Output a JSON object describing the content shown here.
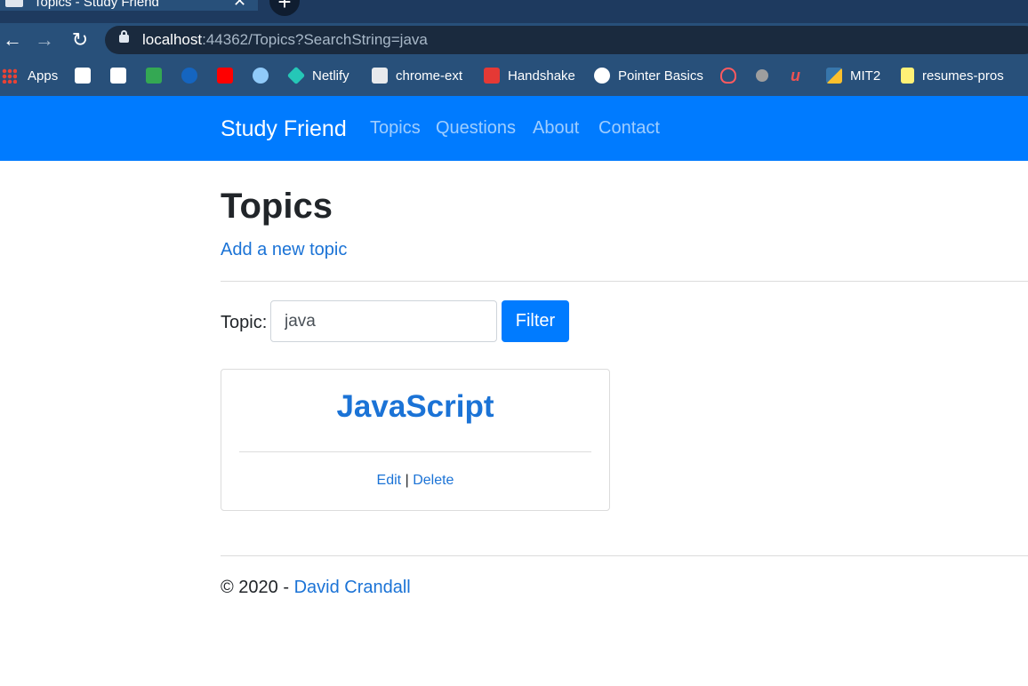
{
  "browser": {
    "tab_title": "Topics - Study Friend",
    "url_host": "localhost",
    "url_rest": ":44362/Topics?SearchString=java",
    "bookmarks": [
      {
        "label": "Apps",
        "icon": "apps-grid-icon"
      },
      {
        "label": "",
        "icon": "amazon-icon",
        "color": "#ffffff"
      },
      {
        "label": "",
        "icon": "gmail-icon",
        "color": "#ffffff"
      },
      {
        "label": "",
        "icon": "bookmark-app-icon",
        "color": "#34a853"
      },
      {
        "label": "",
        "icon": "edge-icon",
        "color": "#1565c0"
      },
      {
        "label": "",
        "icon": "youtube-icon",
        "color": "#ff0000"
      },
      {
        "label": "",
        "icon": "cloud-download-icon",
        "color": "#90caf9"
      },
      {
        "label": "Netlify",
        "icon": "netlify-icon",
        "color": "#25c7b7"
      },
      {
        "label": "chrome-ext",
        "icon": "chrome-ext-icon",
        "color": "#e8eaed"
      },
      {
        "label": "Handshake",
        "icon": "handshake-icon",
        "color": "#e53935"
      },
      {
        "label": "Pointer Basics",
        "icon": "globe-icon",
        "color": "#ffffff"
      },
      {
        "label": "",
        "icon": "airbnb-icon",
        "color": "#ff5a5f"
      },
      {
        "label": "",
        "icon": "apple-icon",
        "color": "#9e9e9e"
      },
      {
        "label": "",
        "icon": "udemy-icon",
        "color": "#ec5252"
      },
      {
        "label": "MIT2",
        "icon": "python-icon",
        "color": "#fbc02d"
      },
      {
        "label": "resumes-pros",
        "icon": "folder-icon",
        "color": "#fff176"
      }
    ]
  },
  "navbar": {
    "brand": "Study Friend",
    "links": [
      "Topics",
      "Questions",
      "About",
      "Contact"
    ]
  },
  "main": {
    "title": "Topics",
    "add_link": "Add a new topic",
    "filter": {
      "label": "Topic:",
      "value": "java",
      "button": "Filter"
    },
    "cards": [
      {
        "title": "JavaScript",
        "edit": "Edit",
        "separator": "|",
        "delete": "Delete"
      }
    ]
  },
  "footer": {
    "copyright": "© 2020 -",
    "author": "David Crandall"
  }
}
